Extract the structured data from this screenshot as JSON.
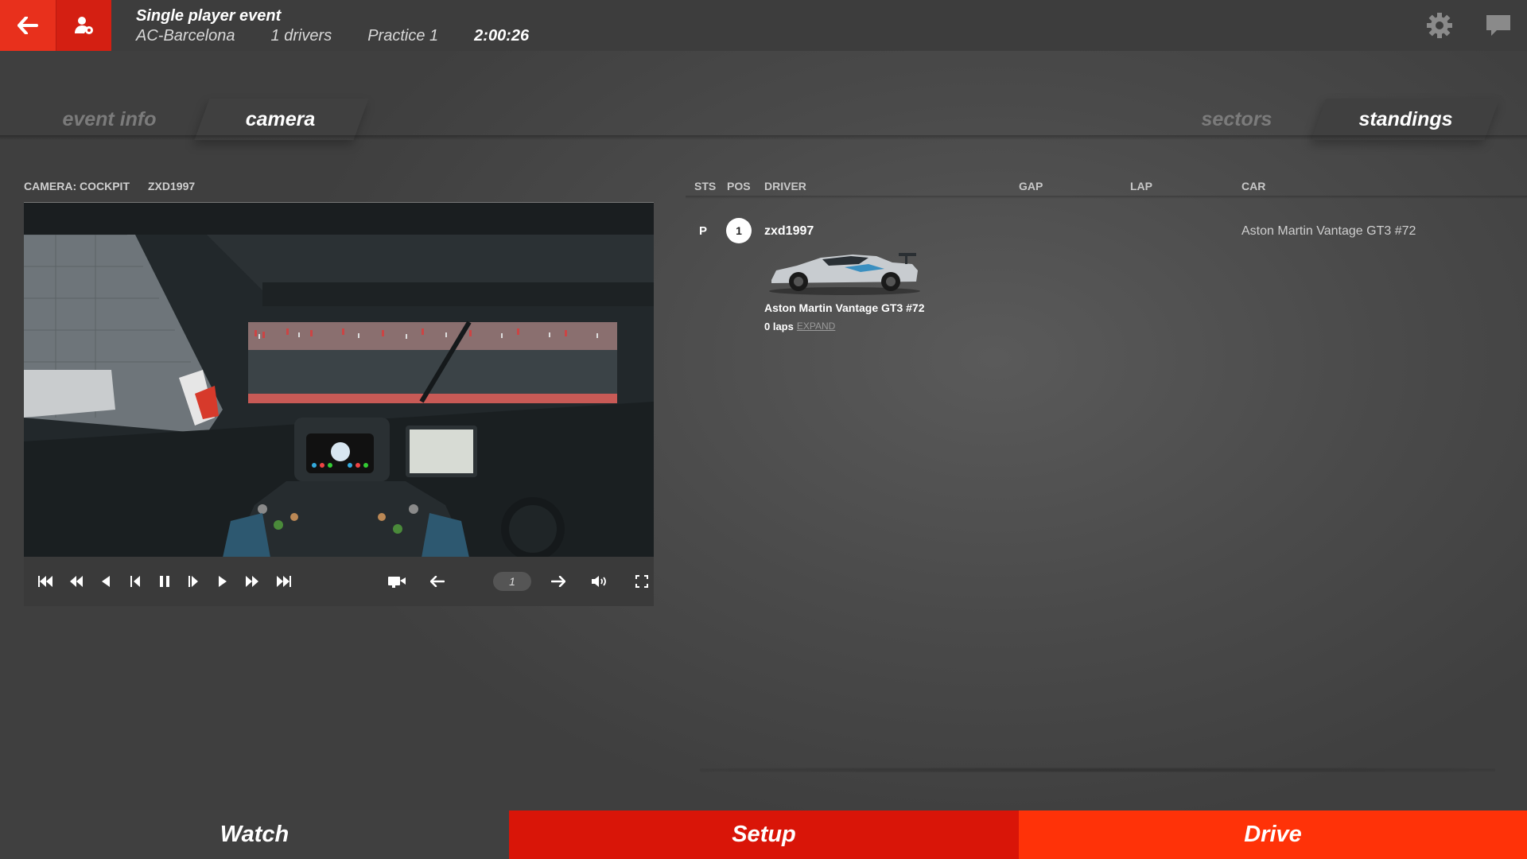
{
  "header": {
    "title": "Single player event",
    "track": "AC-Barcelona",
    "drivers": "1 drivers",
    "session": "Practice 1",
    "time": "2:00:26",
    "icons": [
      "back-arrow-icon",
      "user-settings-icon",
      "gear-icon",
      "chat-icon"
    ]
  },
  "tabs": {
    "left": [
      {
        "label": "event info",
        "active": false
      },
      {
        "label": "camera",
        "active": true
      }
    ],
    "right": [
      {
        "label": "sectors",
        "active": false
      },
      {
        "label": "standings",
        "active": true
      }
    ]
  },
  "camera": {
    "mode_label": "CAMERA: COCKPIT",
    "driver": "ZXD1997",
    "page_number": "1",
    "controls": [
      "skip-start",
      "fast-rewind",
      "rewind",
      "step-back",
      "pause",
      "step-forward",
      "play",
      "fast-forward",
      "skip-end",
      "camera",
      "prev",
      "next",
      "volume",
      "fullscreen"
    ]
  },
  "standings": {
    "columns": [
      "STS",
      "POS",
      "DRIVER",
      "GAP",
      "LAP",
      "CAR"
    ],
    "rows": [
      {
        "sts": "P",
        "pos": "1",
        "driver": "zxd1997",
        "gap": "",
        "lap": "",
        "car": "Aston Martin Vantage GT3 #72",
        "car_caption": "Aston Martin Vantage GT3 #72",
        "laps": "0 laps",
        "expand": "EXPAND"
      }
    ]
  },
  "footer": {
    "watch": "Watch",
    "setup": "Setup",
    "drive": "Drive"
  },
  "colors": {
    "accent_red": "#e8301c",
    "setup_red": "#d91508",
    "drive_orange": "#ff3208"
  }
}
